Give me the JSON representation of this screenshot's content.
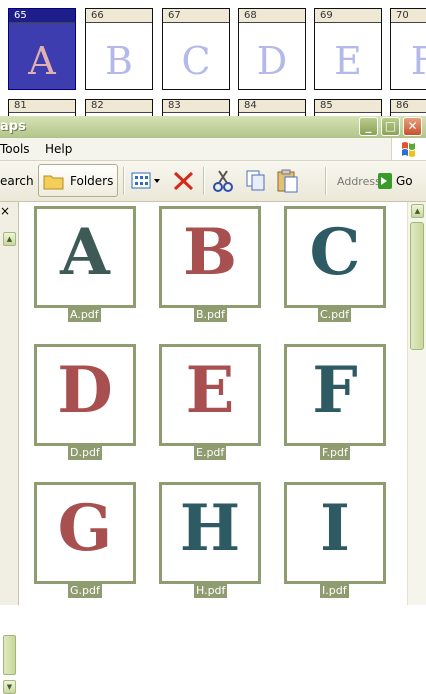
{
  "background_sheet": {
    "cells": [
      {
        "num": "65",
        "letter": "A",
        "selected": true
      },
      {
        "num": "66",
        "letter": "B"
      },
      {
        "num": "67",
        "letter": "C"
      },
      {
        "num": "68",
        "letter": "D"
      },
      {
        "num": "69",
        "letter": "E"
      },
      {
        "num": "70",
        "letter": "F"
      }
    ],
    "row2": [
      "81",
      "82",
      "83",
      "84",
      "85",
      "86"
    ]
  },
  "window": {
    "title": "aps",
    "menu": {
      "tools": "Tools",
      "help": "Help"
    },
    "toolbar": {
      "search": "earch",
      "folders": "Folders",
      "address": "Address",
      "go": "Go"
    },
    "controls": {
      "minimize": "_",
      "maximize": "□",
      "close": "✕"
    },
    "leftpane_close": "×",
    "files": [
      {
        "name": "A.pdf",
        "letter": "A",
        "color": "#3d5a56"
      },
      {
        "name": "B.pdf",
        "letter": "B",
        "color": "#a8504f"
      },
      {
        "name": "C.pdf",
        "letter": "C",
        "color": "#2e5a63"
      },
      {
        "name": "D.pdf",
        "letter": "D",
        "color": "#a8504f"
      },
      {
        "name": "E.pdf",
        "letter": "E",
        "color": "#a8504f"
      },
      {
        "name": "F.pdf",
        "letter": "F",
        "color": "#2e5a63"
      },
      {
        "name": "G.pdf",
        "letter": "G",
        "color": "#a8504f"
      },
      {
        "name": "H.pdf",
        "letter": "H",
        "color": "#2e5a63"
      },
      {
        "name": "I.pdf",
        "letter": "I",
        "color": "#2e5a63"
      }
    ]
  },
  "colors": {
    "accent_green": "#8f9c6f",
    "xp_olive": "#b2c48a"
  }
}
